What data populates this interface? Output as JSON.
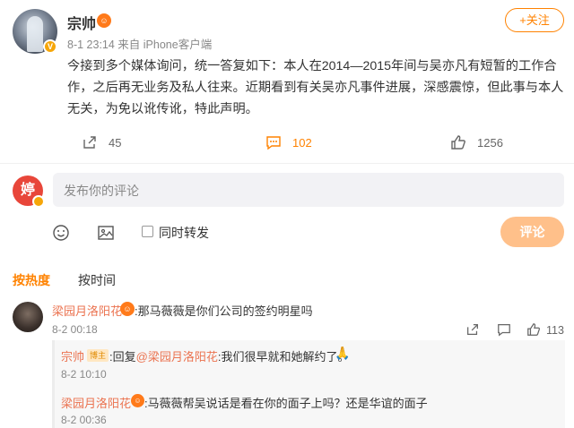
{
  "post": {
    "author": "宗帅",
    "member_badge": "V",
    "meta": "8-1 23:14 来自 iPhone客户端",
    "follow_label": "+关注",
    "body": "今接到多个媒体询问，统一答复如下：本人在2014—2015年间与吴亦凡有短暂的工作合作，之后再无业务及私人往来。近期看到有关吴亦凡事件进展，深感震惊，但此事与本人无关，为免以讹传讹，特此声明。",
    "shares": "45",
    "comments": "102",
    "likes": "1256"
  },
  "composer": {
    "avatar_text": "婷",
    "placeholder": "发布你的评论",
    "repost_label": "同时转发",
    "submit_label": "评论"
  },
  "sort": {
    "hot": "按热度",
    "time": "按时间"
  },
  "comment": {
    "author": "梁园月洛阳花",
    "text": ":那马薇薇是你们公司的签约明星吗",
    "time": "8-2 00:18",
    "likes": "113"
  },
  "replies": [
    {
      "author": "宗帅",
      "tag": "博主",
      "prefix": ":回复",
      "mention": "@梁园月洛阳花",
      "text": ":我们很早就和她解约了。",
      "emoji": "🙏",
      "time": "8-2 10:10"
    },
    {
      "author": "梁园月洛阳花",
      "text": ":马薇薇帮吴说话是看在你的面子上吗？还是华谊的面子",
      "time": "8-2 00:36"
    }
  ],
  "colors": {
    "accent": "#ff8200",
    "name_link": "#eb7350",
    "submit_disabled": "#ffc08a"
  }
}
